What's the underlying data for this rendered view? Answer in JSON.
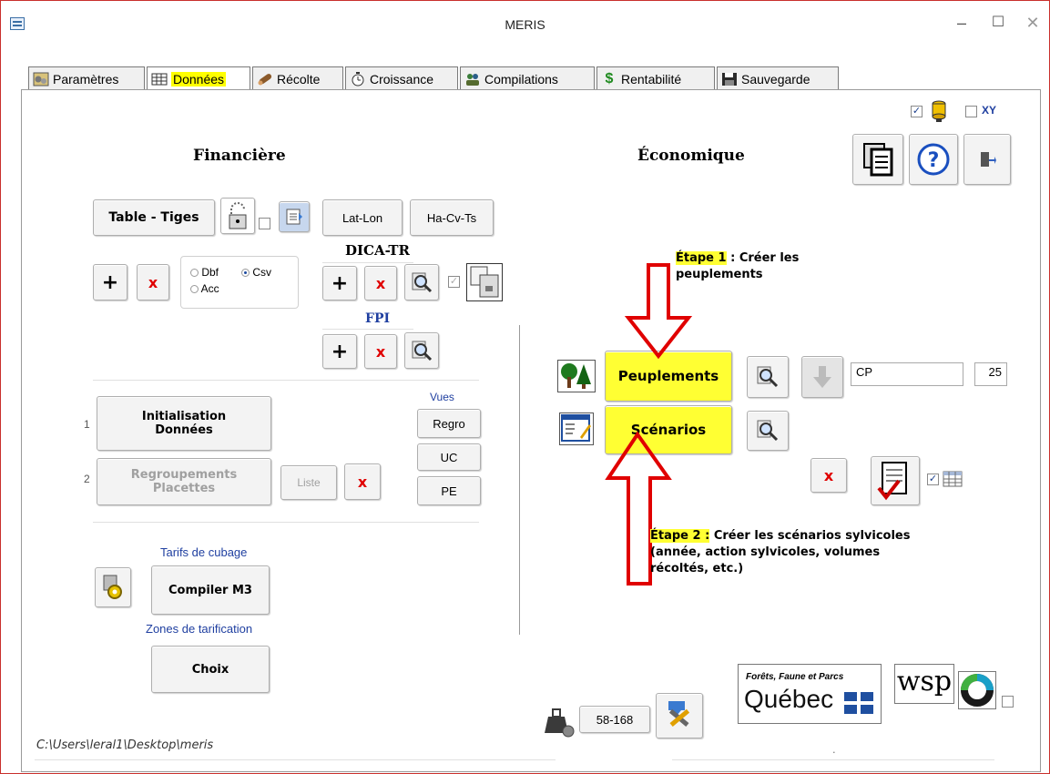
{
  "window": {
    "title": "MERIS",
    "minimize": "–",
    "maximize": "☐",
    "close": "✕"
  },
  "tabs": [
    {
      "label": "Paramètres",
      "icon": "gears-icon"
    },
    {
      "label": "Données",
      "icon": "table-icon",
      "active": true
    },
    {
      "label": "Récolte",
      "icon": "log-icon"
    },
    {
      "label": "Croissance",
      "icon": "stopwatch-icon"
    },
    {
      "label": "Compilations",
      "icon": "team-icon"
    },
    {
      "label": "Rentabilité",
      "icon": "dollar-icon"
    },
    {
      "label": "Sauvegarde",
      "icon": "save-icon"
    }
  ],
  "top_right": {
    "xy_label": "XY"
  },
  "financiere": {
    "heading": "Financière",
    "table_tiges": "Table - Tiges",
    "lat_lon": "Lat-Lon",
    "ha_cv_ts": "Ha-Cv-Ts",
    "plus": "+",
    "x": "x",
    "format": {
      "dbf": "Dbf",
      "csv": "Csv",
      "acc": "Acc",
      "selected": "Csv"
    }
  },
  "dica": {
    "label": "DICA-TR",
    "plus": "+",
    "x": "x"
  },
  "fpi": {
    "label": "FPI",
    "plus": "+",
    "x": "x"
  },
  "donnees": {
    "vues_label": "Vues",
    "row1_num": "1",
    "row2_num": "2",
    "init_line1": "Initialisation",
    "init_line2": "Données",
    "regroup_line1": "Regroupements",
    "regroup_line2": "Placettes",
    "liste": "Liste",
    "x": "x",
    "regro": "Regro",
    "uc": "UC",
    "pe": "PE"
  },
  "cubage": {
    "tarifs_label": "Tarifs de cubage",
    "compiler": "Compiler M3",
    "zones_label": "Zones de tarification",
    "choix": "Choix"
  },
  "economique": {
    "heading": "Économique",
    "peuplements": "Peuplements",
    "scenarios": "Scénarios",
    "cp_value": "CP",
    "count_value": "25",
    "x": "x"
  },
  "annotations": {
    "step1_tag": "Étape 1",
    "step1_text_a": " : Créer les",
    "step1_text_b": "peuplements",
    "step2_tag": "Étape 2 :",
    "step2_text_a": " Créer les scénarios sylvicoles",
    "step2_text_b": "(année, action sylvicoles, volumes",
    "step2_text_c": "récoltés, etc.)"
  },
  "footer": {
    "path": "C:\\Users\\leral1\\Desktop\\meris",
    "version": "58-168",
    "logo_ffp_line1": "Forêts, Faune et Parcs",
    "logo_ffp_line2": "Québec",
    "logo_wsp": "wsp",
    "dot": "."
  },
  "colors": {
    "highlight": "#ffff33",
    "arrow": "#e00000",
    "accent_blue": "#1f3fa0"
  }
}
